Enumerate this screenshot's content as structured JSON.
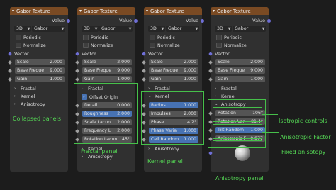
{
  "node_title": "Gabor Texture",
  "value_label": "Value",
  "dim_selector": "3D",
  "type_selector": "Gabor",
  "periodic_label": "Periodic",
  "normalize_label": "Normalize",
  "vector_label": "Vector",
  "inputs": {
    "scale": {
      "label": "Scale",
      "value": "2.000"
    },
    "base_freq": {
      "label": "Base Freque",
      "value": "9.000"
    },
    "gain": {
      "label": "Gain",
      "value": "1.000"
    }
  },
  "panels": {
    "fractal": "Fractal",
    "kernel": "Kernel",
    "anisotropy": "Anisotropy"
  },
  "fractal": {
    "offset_origin": "Offset Origin",
    "detail": {
      "label": "Detail",
      "value": "0.000"
    },
    "roughness": {
      "label": "Roughness",
      "value": "2.000"
    },
    "scale_lacun": {
      "label": "Scale Lacun",
      "value": "2.000"
    },
    "frequency_l": {
      "label": "Frequency L",
      "value": "2.000"
    },
    "rotation_lacun": {
      "label": "Rotation Lacun",
      "value": "45°"
    }
  },
  "kernel": {
    "radius": {
      "label": "Radius",
      "value": "1.000"
    },
    "impulses": {
      "label": "Impulses",
      "value": "2.000"
    },
    "phase": {
      "label": "Phase",
      "value": "4.2°"
    },
    "phase_vari": {
      "label": "Phase Varia",
      "value": "1.000"
    },
    "cell_random": {
      "label": "Cell Random",
      "value": "1.000"
    }
  },
  "anisotropy": {
    "rotation": {
      "label": "Rotation",
      "value": "106°"
    },
    "rotation_vari": {
      "label": "Rotation Vari",
      "value": "81.4°"
    },
    "tilt_random": {
      "label": "Tilt Random",
      "value": "1.000"
    },
    "anisotropic_f": {
      "label": "Anisotropic F",
      "value": "0.877"
    }
  },
  "captions": {
    "collapsed": "Collapsed panels",
    "fractal": "Fractal panel",
    "kernel": "Kernel panel",
    "anisotropy": "Anisotropy panel",
    "isotropic": "Isotropic controls",
    "anisotropic_factor": "Anisotropic Factor",
    "fixed": "Fixed anisotopy"
  },
  "colors": {
    "header": "#7a4a23",
    "highlight_blue": "#4772b3",
    "callout_green": "#46c04a",
    "node_bg": "#303030"
  },
  "icons": {
    "panel_open": "chevron-down-icon",
    "panel_closed": "chevron-right-icon",
    "socket": "socket-icon",
    "checkbox_checked": "checkmark-icon",
    "preview": "sphere-preview"
  }
}
